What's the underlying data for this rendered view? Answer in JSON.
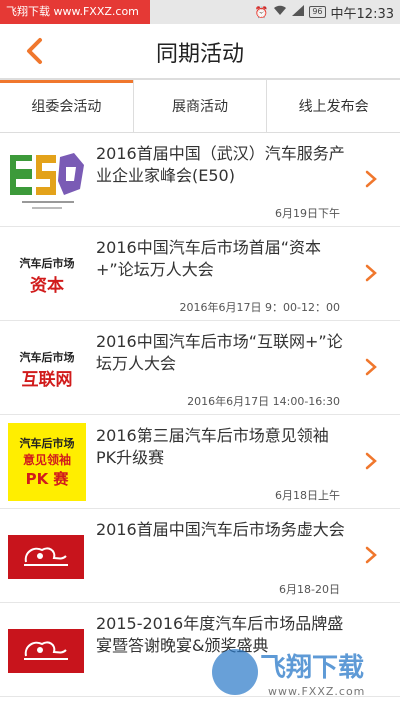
{
  "status_bar": {
    "watermark_text": "飞翔下载 www.FXXZ.com",
    "battery": "96",
    "time": "中午12:33",
    "icons": [
      "screenshot-icon",
      "alarm-icon",
      "wifi-icon",
      "signal-icon",
      "battery-icon"
    ]
  },
  "header": {
    "title": "同期活动",
    "back_icon": "chevron-left-icon",
    "accent_color": "#f0772d"
  },
  "tabs": [
    {
      "label": "组委会活动",
      "active": true
    },
    {
      "label": "展商活动",
      "active": false
    },
    {
      "label": "线上发布会",
      "active": false
    }
  ],
  "events": [
    {
      "title": "2016首届中国（武汉）汽车服务产业企业家峰会(E50)",
      "date": "6月19日下午",
      "logo": "E50"
    },
    {
      "title": "2016中国汽车后市场首届“资本+”论坛万人大会",
      "date": "2016年6月17日 9：00-12：00",
      "logo_line1": "汽车后市场",
      "logo_line2": "资本"
    },
    {
      "title": "2016中国汽车后市场“互联网+”论坛万人大会",
      "date": "2016年6月17日  14:00-16:30",
      "logo_line1": "汽车后市场",
      "logo_line2": "互联网"
    },
    {
      "title": "2016第三届汽车后市场意见领袖PK升级赛",
      "date": "6月18日上午",
      "logo_line1": "汽车后市场",
      "logo_line2": "意见领袖",
      "logo_line3": "PK 赛"
    },
    {
      "title": "2016首届中国汽车后市场务虚大会",
      "date": "6月18-20日",
      "logo": "red-brand-logo"
    },
    {
      "title": "2015-2016年度汽车后市场品牌盛宴暨答谢晚宴&颁奖盛典",
      "date": "",
      "logo": "red-brand-logo"
    }
  ],
  "watermark_bottom": {
    "text": "飞翔下载",
    "url": "www.FXXZ.com"
  }
}
